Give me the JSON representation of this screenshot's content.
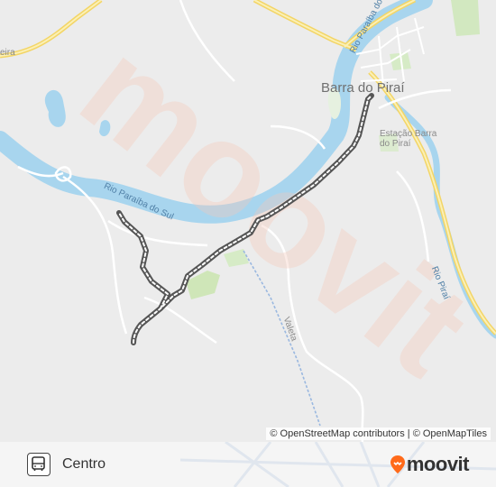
{
  "map": {
    "city_label": "Barra do Piraí",
    "station_label_line1": "Estação Barra",
    "station_label_line2": "do Piraí",
    "river_paraiba_top": "Rio Paraíba do Sul",
    "river_paraiba_center": "Rio Paraíba do Sul",
    "river_pirai": "Rio Piraí",
    "road_label": "Valeta",
    "edge_label": "eira",
    "watermark": "moovit",
    "colors": {
      "water": "#a8d5ee",
      "water_text": "#4f7fa6",
      "major_road": "#f8e16c",
      "route_line": "#555555",
      "rail": "#9ab8e0",
      "park": "#cfe6b8",
      "watermark": "#f6c8b8"
    }
  },
  "attribution": {
    "osm": "© OpenStreetMap contributors",
    "separator": "|",
    "omt": "© OpenMapTiles"
  },
  "footer": {
    "route_icon": "bus-icon",
    "route_name": "Centro",
    "brand": "moovit",
    "brand_icon": "moovit-pin-icon",
    "brand_color": "#ff6a1a"
  }
}
